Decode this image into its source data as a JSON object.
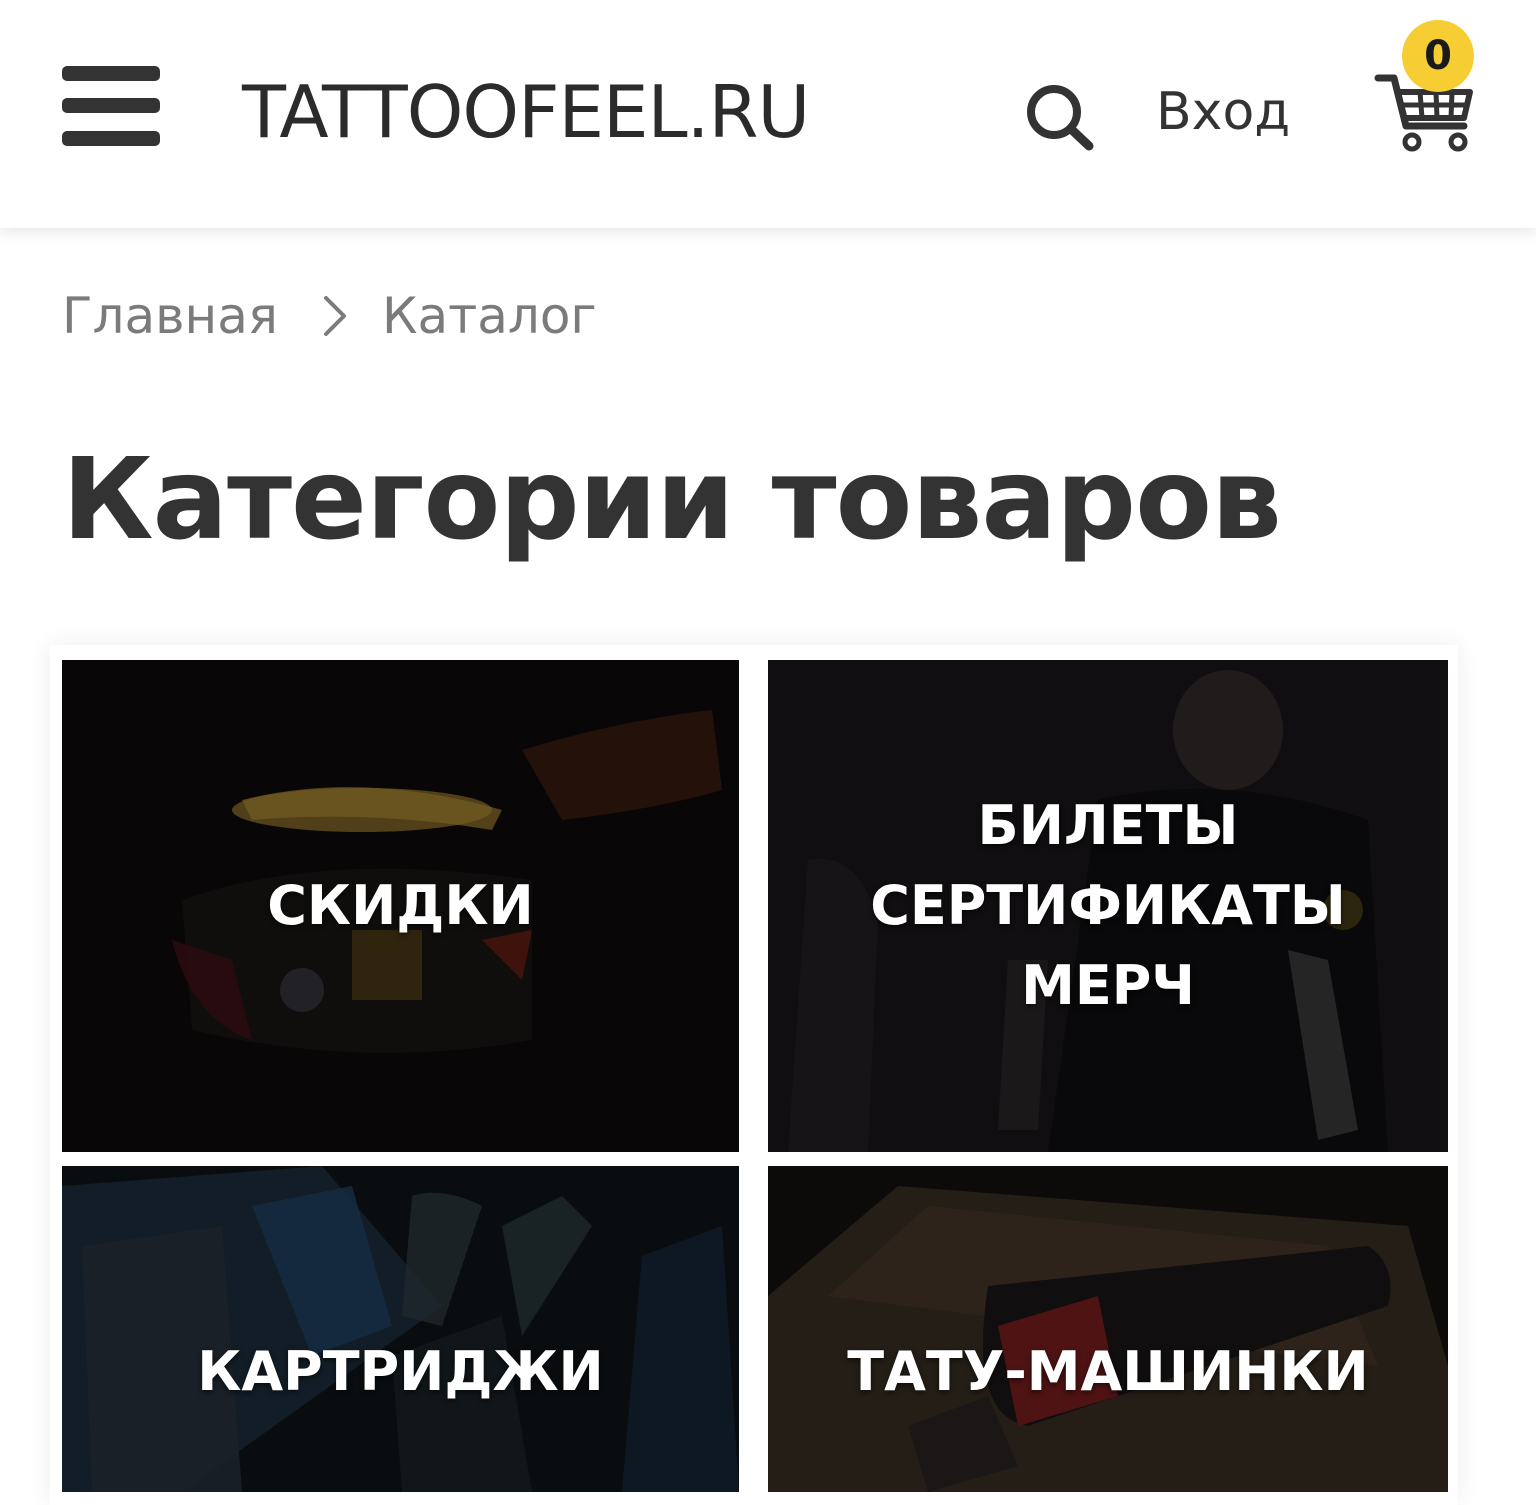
{
  "header": {
    "logo": "TATTOOFEEL.RU",
    "login_label": "Вход",
    "cart_count": "0",
    "icons": [
      "menu-icon",
      "search-icon",
      "cart-icon"
    ],
    "badge_color": "#f7cd34"
  },
  "breadcrumb": {
    "items": [
      "Главная",
      "Каталог"
    ]
  },
  "page": {
    "title": "Категории товаров"
  },
  "categories": [
    {
      "lines": [
        "СКИДКИ"
      ]
    },
    {
      "lines": [
        "БИЛЕТЫ",
        "СЕРТИФИКАТЫ",
        "МЕРЧ"
      ]
    },
    {
      "lines": [
        "КАРТРИДЖИ"
      ]
    },
    {
      "lines": [
        "ТАТУ-МАШИНКИ"
      ]
    }
  ]
}
